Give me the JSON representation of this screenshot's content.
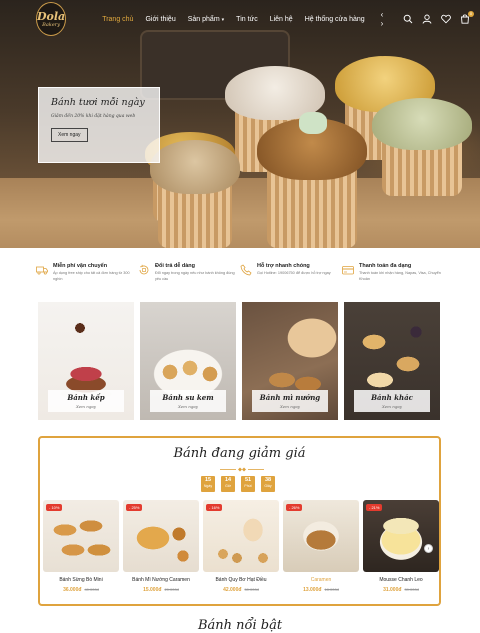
{
  "header": {
    "logo_main": "Dola",
    "logo_sub": "Bakery",
    "menu": [
      {
        "label": "Trang chủ",
        "active": true
      },
      {
        "label": "Giới thiệu",
        "active": false
      },
      {
        "label": "Sản phẩm",
        "active": false,
        "has_dropdown": true
      },
      {
        "label": "Tin tức",
        "active": false
      },
      {
        "label": "Liên hệ",
        "active": false
      },
      {
        "label": "Hệ thống cửa hàng",
        "active": false
      }
    ],
    "arrows": "‹ ›",
    "icons": [
      "search-icon",
      "user-icon",
      "heart-icon",
      "cart-icon"
    ],
    "cart_count": "0"
  },
  "hero": {
    "title": "Bánh tươi mỗi ngày",
    "subtitle": "Giảm đến 20% khi đặt hàng qua web",
    "button": "Xem ngay"
  },
  "features": [
    {
      "icon": "truck-icon",
      "title": "Miễn phí vận chuyển",
      "text": "Áp dụng free ship cho tất cả đơn hàng từ 300 nghìn"
    },
    {
      "icon": "return-icon",
      "title": "Đổi trả dễ dàng",
      "text": "Đổi ngay trong ngày nếu như bánh không đúng yêu cầu"
    },
    {
      "icon": "phone-icon",
      "title": "Hỗ trợ nhanh chóng",
      "text": "Gọi Hotline: 19006750 để được hỗ trợ ngay"
    },
    {
      "icon": "card-icon",
      "title": "Thanh toán đa dạng",
      "text": "Thanh toán khi nhận hàng, Napas, Visa, Chuyển Khoản"
    }
  ],
  "categories": [
    {
      "name": "Bánh kếp",
      "more": "Xem ngay"
    },
    {
      "name": "Bánh su kem",
      "more": "Xem ngay"
    },
    {
      "name": "Bánh mì nướng",
      "more": "Xem ngay"
    },
    {
      "name": "Bánh khác",
      "more": "Xem ngay"
    }
  ],
  "sale": {
    "title": "Bánh đang giảm giá",
    "timer": [
      {
        "value": "15",
        "unit": "Ngày"
      },
      {
        "value": "14",
        "unit": "Giờ"
      },
      {
        "value": "51",
        "unit": "Phút"
      },
      {
        "value": "38",
        "unit": "Giây"
      }
    ],
    "products": [
      {
        "discount": "- 10%",
        "name": "Bánh Sừng Bò Mini",
        "price": "36.000đ",
        "old_price": "40.000đ",
        "highlight": false
      },
      {
        "discount": "- 25%",
        "name": "Bánh Mì Nướng Caramen",
        "price": "15.000đ",
        "old_price": "20.000đ",
        "highlight": false
      },
      {
        "discount": "- 16%",
        "name": "Bánh Quy Bơ Hạt Điều",
        "price": "42.000đ",
        "old_price": "50.000đ",
        "highlight": false
      },
      {
        "discount": "- 26%",
        "name": "Caramen",
        "price": "13.000đ",
        "old_price": "18.000đ",
        "highlight": true
      },
      {
        "discount": "- 21%",
        "name": "Mousse Chanh Leo",
        "price": "31.000đ",
        "old_price": "39.000đ",
        "highlight": false
      }
    ],
    "next_arrow": "›"
  },
  "next_section_title": "Bánh nổi bật"
}
